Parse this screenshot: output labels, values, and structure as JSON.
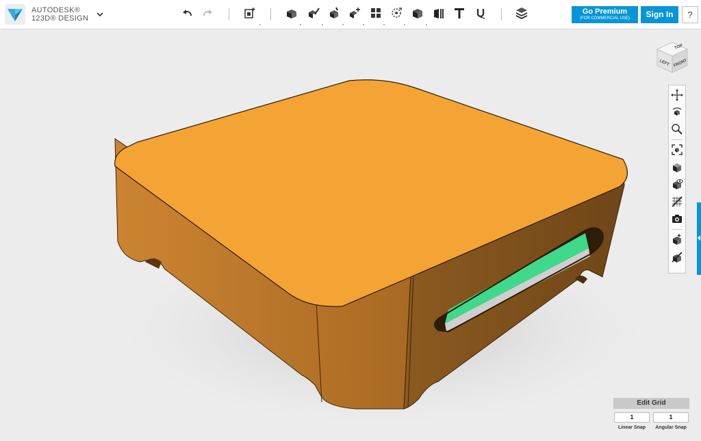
{
  "app": {
    "brand_line1": "AUTODESK®",
    "brand_line2": "123D® DESIGN"
  },
  "toolbar": {
    "tools": [
      {
        "name": "undo-icon"
      },
      {
        "name": "redo-icon"
      },
      {
        "name": "primitives-icon"
      },
      {
        "name": "sketch-icon"
      },
      {
        "name": "construct-icon"
      },
      {
        "name": "modify-icon"
      },
      {
        "name": "pattern-icon"
      },
      {
        "name": "grouping-icon"
      },
      {
        "name": "combine-icon"
      },
      {
        "name": "measure-icon"
      },
      {
        "name": "text-tool-icon"
      },
      {
        "name": "snap-icon"
      },
      {
        "name": "materials-icon"
      }
    ],
    "premium_label": "Go Premium",
    "premium_sublabel": "(FOR COMMERCIAL USE)",
    "signin_label": "Sign In",
    "help_label": "?"
  },
  "viewcube": {
    "faces": [
      "TOP",
      "LEFT",
      "FRONT"
    ]
  },
  "navigation": {
    "tools": [
      "pan-icon",
      "orbit-icon",
      "zoom-icon",
      "fit-icon",
      "view-materials-icon",
      "visibility-icon",
      "hide-sketches-icon",
      "snapshot-icon",
      "outline-mode-icon",
      "hide-mesh-icon"
    ]
  },
  "colors": {
    "accent": "#0696d7",
    "model_top": "#f4a335",
    "model_side": "#b9772b",
    "model_shadow": "#7c4f1d",
    "pcb": "#3fd98c"
  },
  "grid": {
    "edit_label": "Edit Grid",
    "linear_snap_value": "1",
    "angular_snap_value": "1",
    "linear_snap_label": "Linear Snap",
    "angular_snap_label": "Angular Snap"
  }
}
